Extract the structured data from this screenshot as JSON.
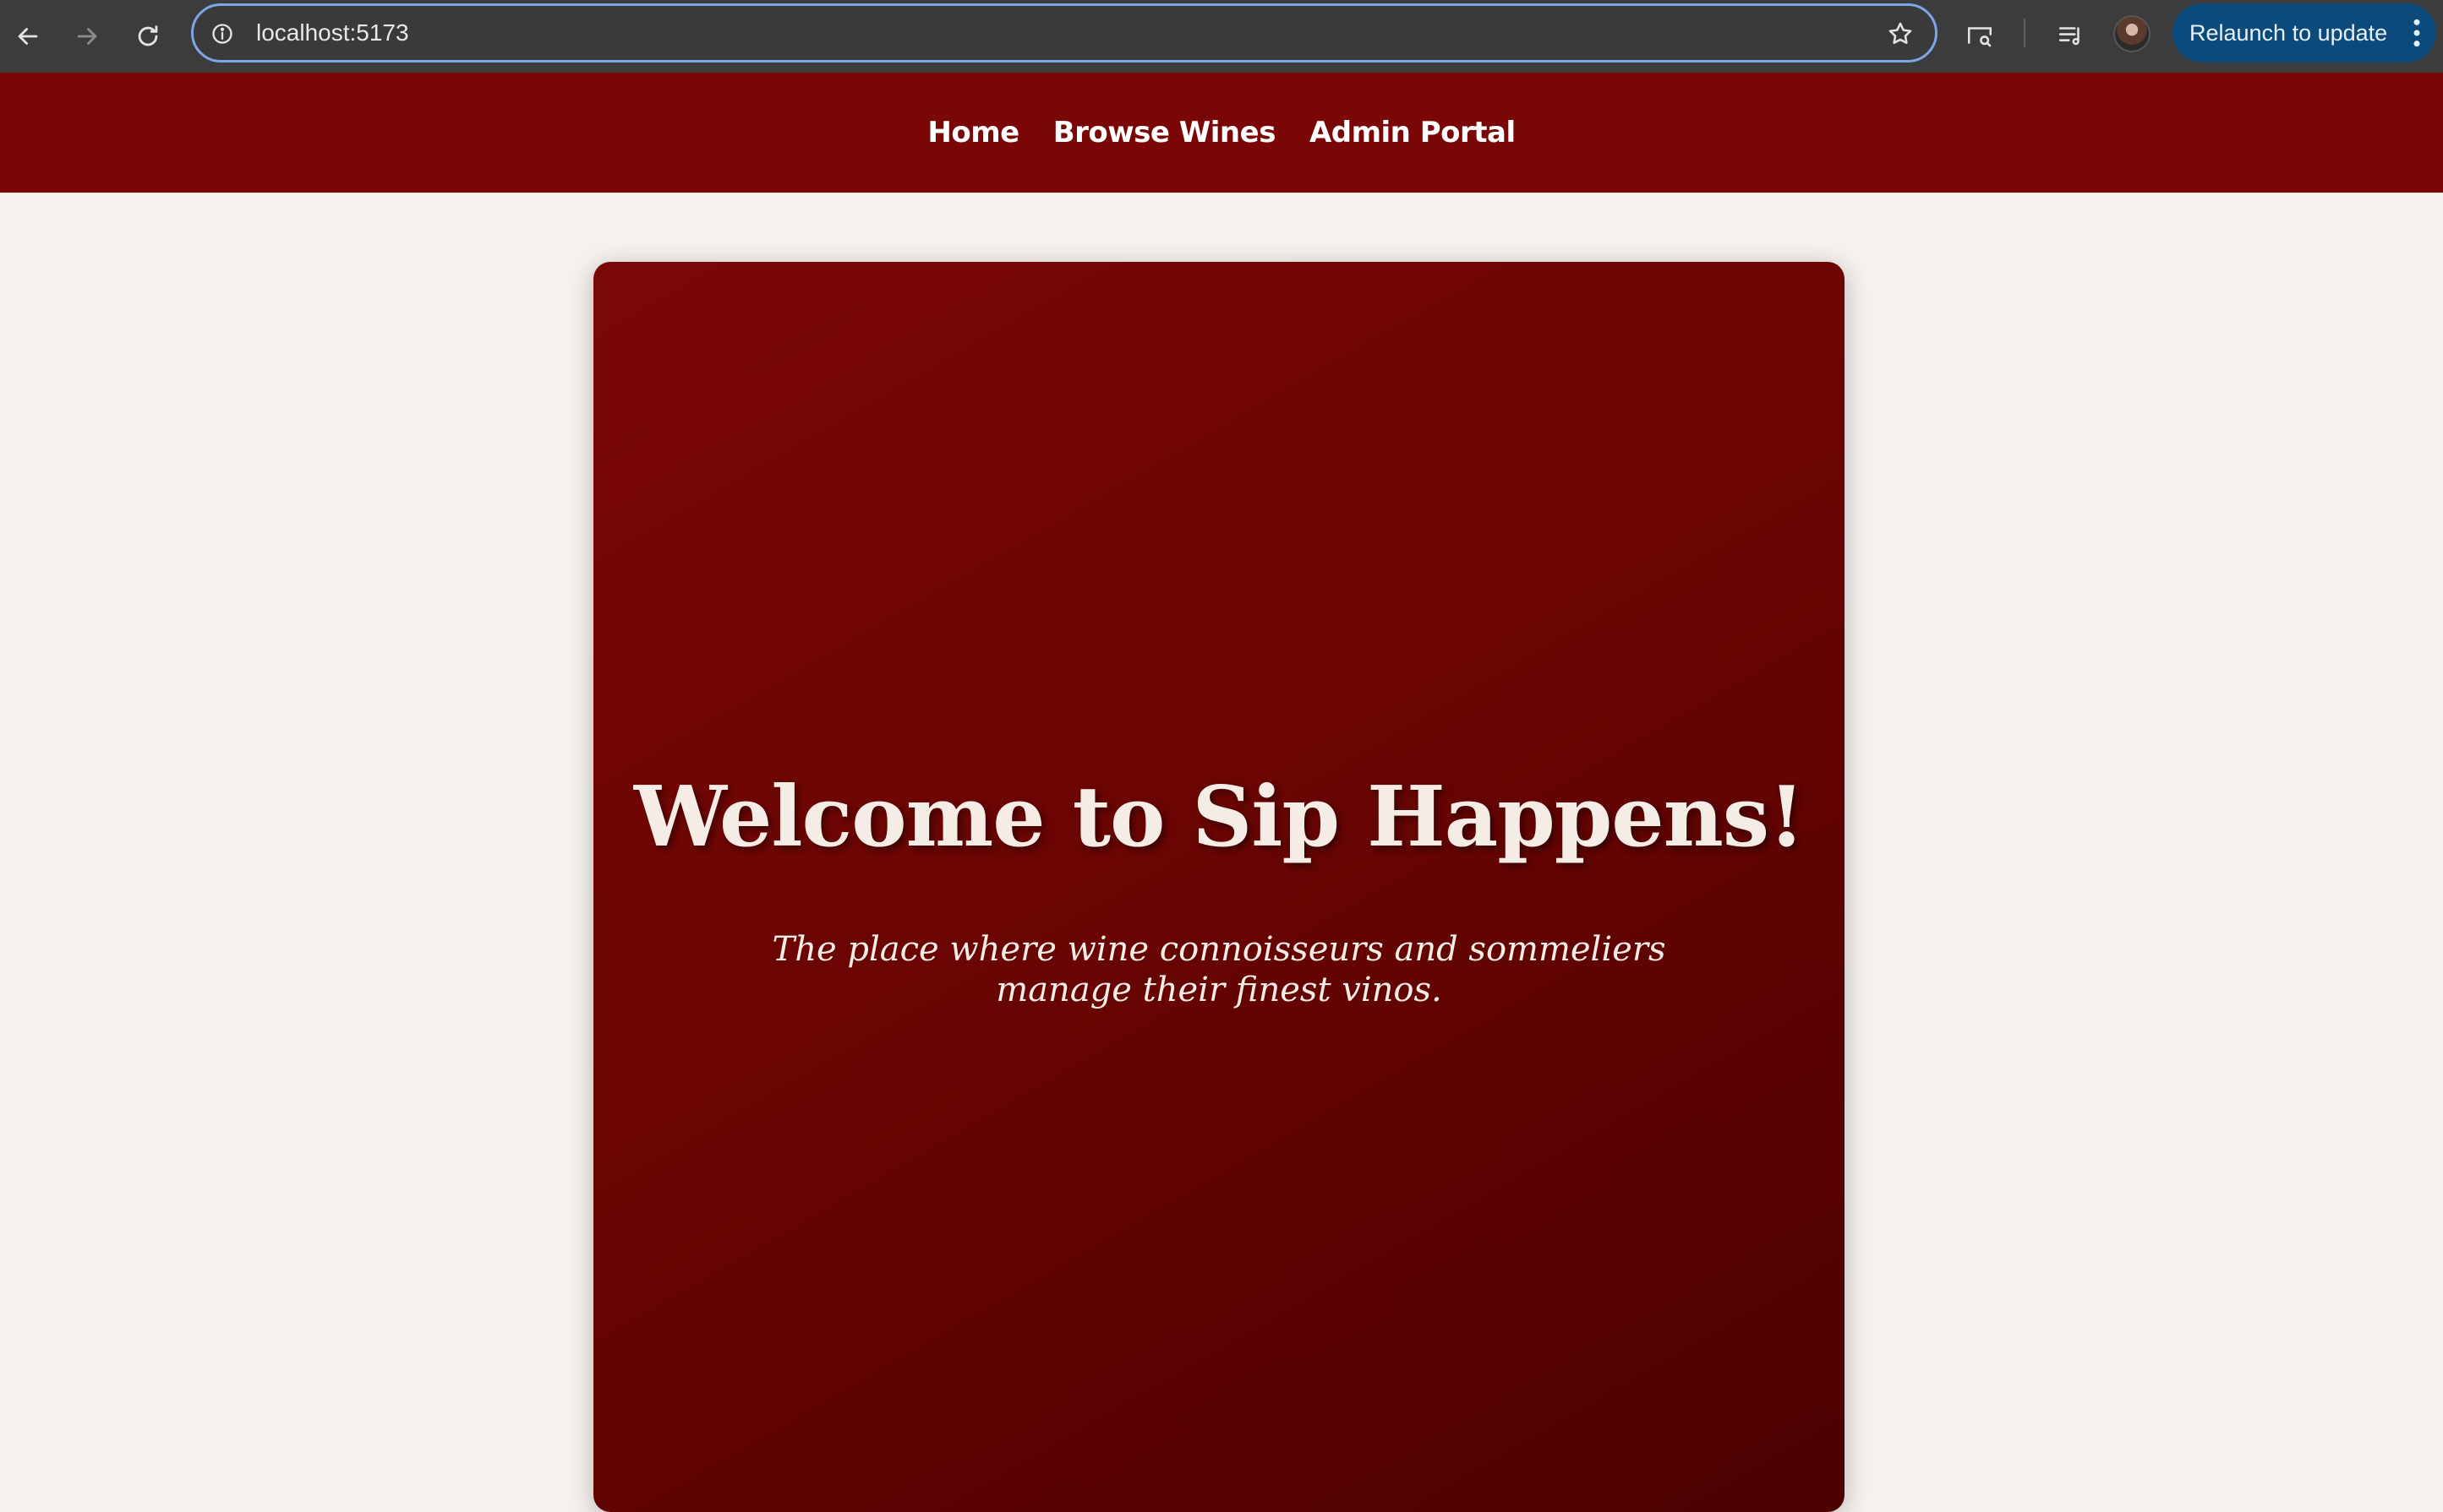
{
  "browser": {
    "url": "localhost:5173",
    "relaunch_label": "Relaunch to update",
    "icons": {
      "back": "arrow-left-icon",
      "forward": "arrow-right-icon",
      "reload": "reload-icon",
      "site_info": "info-icon",
      "bookmark": "star-icon",
      "cast": "cast-search-icon",
      "media": "media-queue-icon",
      "menu": "kebab-menu-icon"
    },
    "colors": {
      "chrome": "#3c3c3c",
      "relaunch_bg": "#0b4a7a"
    }
  },
  "site_nav": {
    "items": [
      {
        "label": "Home"
      },
      {
        "label": "Browse Wines"
      },
      {
        "label": "Admin Portal"
      }
    ],
    "color": "#7a0606"
  },
  "hero": {
    "title": "Welcome to Sip Happens!",
    "subtitle": "The place where wine connoisseurs and sommeliers manage their finest vinos.",
    "color": "#6a0503"
  }
}
